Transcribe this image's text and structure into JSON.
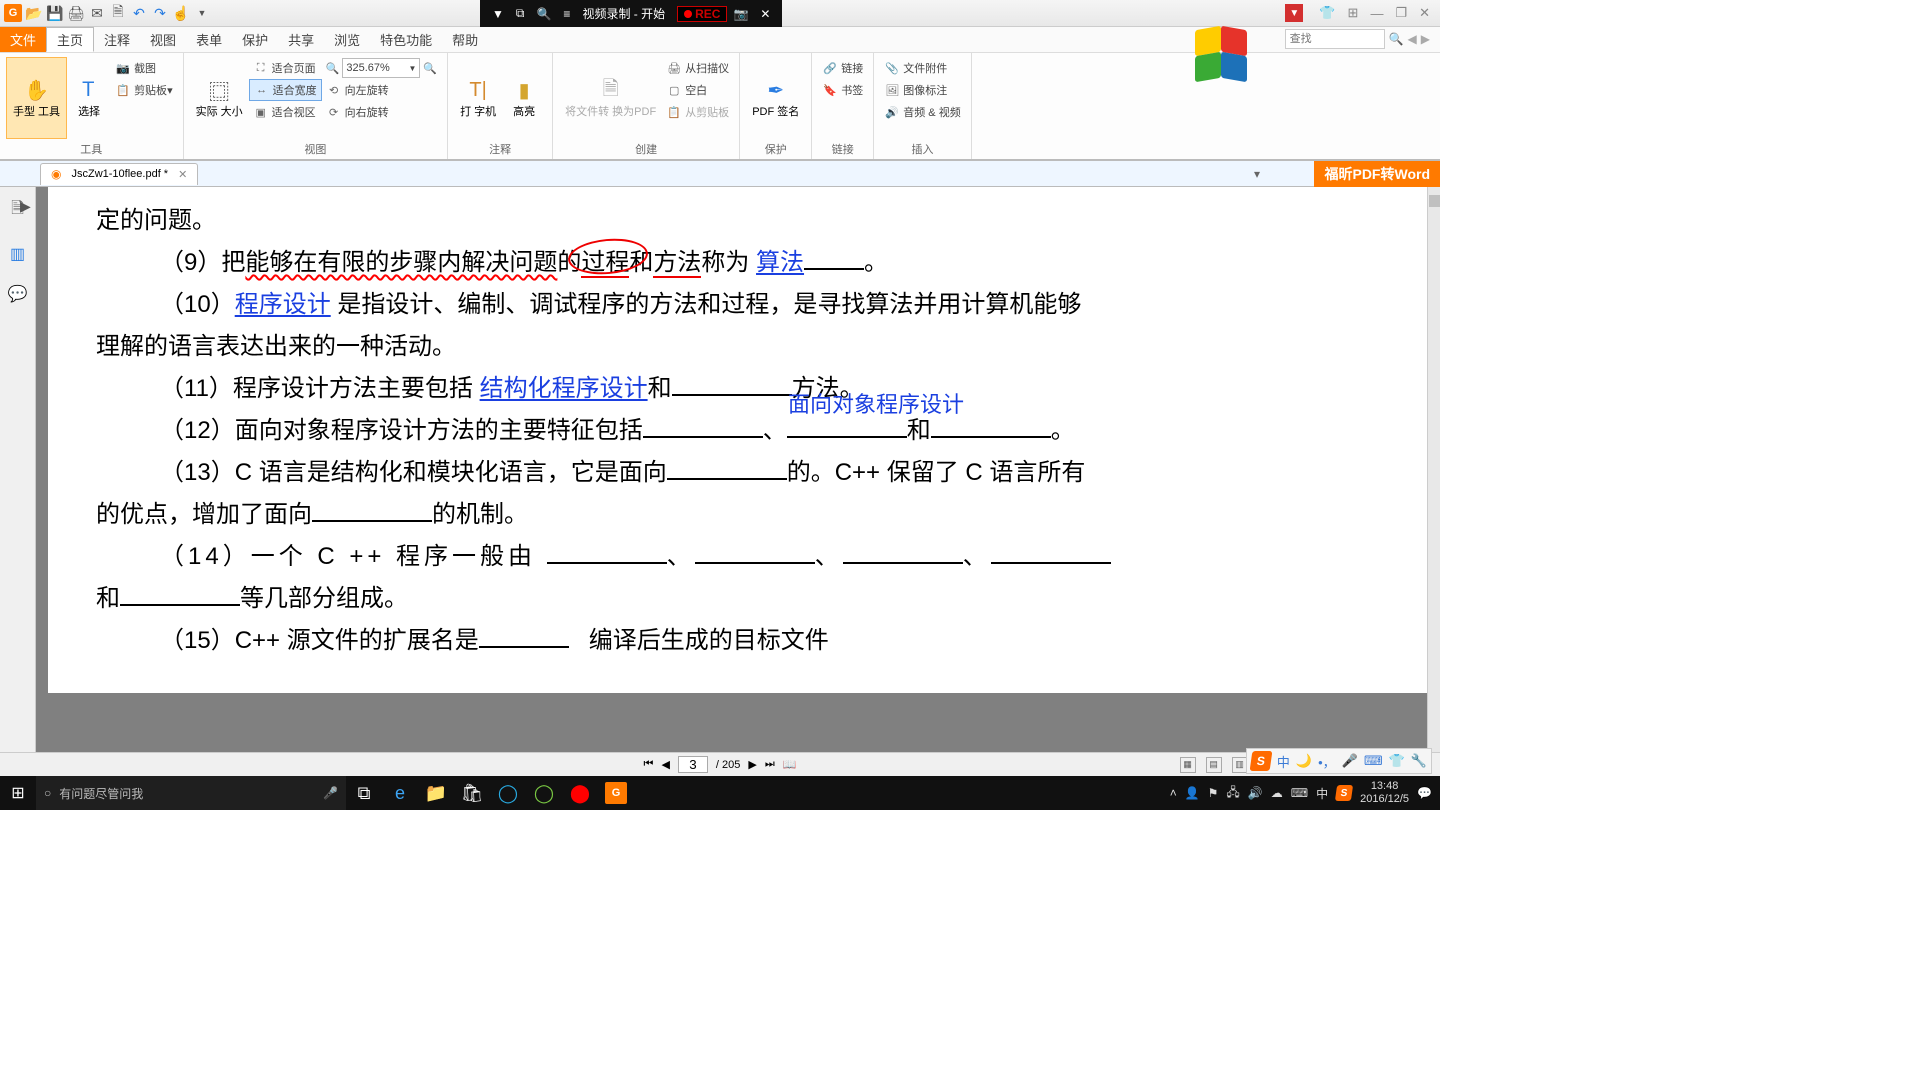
{
  "titlebar": {
    "rec_title": "视频录制 - 开始",
    "rec_label": "REC"
  },
  "menus": {
    "file": "文件",
    "home": "主页",
    "comment": "注释",
    "view": "视图",
    "form": "表单",
    "protect": "保护",
    "share": "共享",
    "browse": "浏览",
    "feature": "特色功能",
    "help": "帮助",
    "search_placeholder": "查找"
  },
  "ribbon": {
    "g_tools": "工具",
    "hand": "手型\n工具",
    "select": "选择",
    "screenshot": "截图",
    "clipboard": "剪贴板",
    "g_view": "视图",
    "actual_size": "实际\n大小",
    "fit_page": "适合页面",
    "fit_width": "适合宽度",
    "fit_vis": "适合视区",
    "zoom_val": "325.67%",
    "rotate_l": "向左旋转",
    "rotate_r": "向右旋转",
    "g_comment": "注释",
    "typewriter": "打\n字机",
    "highlight": "高亮",
    "g_create": "创建",
    "to_pdf": "将文件转\n换为PDF",
    "from_scan": "从扫描仪",
    "blank": "空白",
    "from_clip": "从剪贴板",
    "g_protect": "保护",
    "pdf_sign": "PDF\n签名",
    "g_link": "链接",
    "link": "链接",
    "bookmark": "书签",
    "g_insert": "插入",
    "file_att": "文件附件",
    "img_ann": "图像标注",
    "av": "音频 & 视频"
  },
  "tabs": {
    "doc_name": "JscZw1-10flee.pdf *",
    "pdf_to_word": "福昕PDF转Word"
  },
  "document": {
    "line0": "定的问题。",
    "l9_a": "（9）把",
    "l9_b": "能够在有限的步骤内解决问题",
    "l9_c": "的",
    "l9_c2": "过程",
    "l9_c3": "和",
    "l9_c4": "方法",
    "l9_c5": "称为 ",
    "l9_fill": "算法",
    "l9_d": "。",
    "l10_a": "（10）",
    "l10_fill": "程序设计",
    "l10_b": " 是指设计、编制、调试程序的方法和过程，是寻找算法并用计算机能够",
    "l10_c": "理解的语言表达出来的一种活动。",
    "l11_a": "（11）程序设计方法主要包括 ",
    "l11_fill": "结构化程序设计",
    "l11_mid": "和",
    "l11_b": "方法。",
    "ann_oop": "面向对象程序设计",
    "l12_a": "（12）面向对象程序设计方法的主要特征包括",
    "l12_b": "、",
    "l12_c": "和",
    "l12_d": "。",
    "l13_a": "（13）C 语言是结构化和模块化语言，它是面向",
    "l13_b": "的。C++ 保留了 C 语言所有",
    "l13_c": "的优点，增加了面向",
    "l13_d": "的机制。",
    "l14_a": "（14）一个 C ++ 程序一般由 ",
    "l14_b": "、",
    "l14_c": "和",
    "l14_d": "等几部分组成。",
    "l15_a": "（15）C++ 源文件的扩展名是",
    "l15_b": "编译后生成的目标文件"
  },
  "status": {
    "page_current": "3",
    "page_sep": "/ 205",
    "zoom": "325.67%"
  },
  "taskbar": {
    "cortana": "有问题尽管问我",
    "time": "13:48",
    "date": "2016/12/5",
    "ime": "中"
  }
}
